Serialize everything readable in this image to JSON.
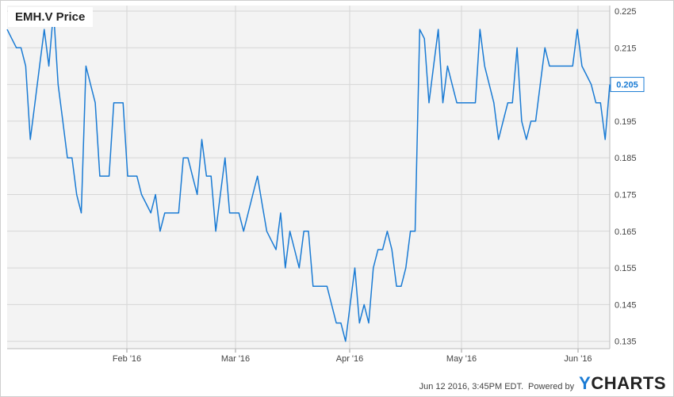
{
  "title": "EMH.V Price",
  "footer": {
    "timestamp": "Jun 12 2016, 3:45PM EDT.",
    "powered_by": "Powered by",
    "brand_y": "Y",
    "brand_rest": "CHARTS"
  },
  "chart_data": {
    "type": "line",
    "title": "EMH.V Price",
    "series": [
      {
        "values": [
          0.22,
          0.2175,
          0.215,
          0.215,
          0.21,
          0.19,
          0.2,
          0.21,
          0.22,
          0.21,
          0.225,
          0.205,
          0.195,
          0.185,
          0.185,
          0.175,
          0.17,
          0.21,
          0.205,
          0.2,
          0.18,
          0.18,
          0.18,
          0.2,
          0.2,
          0.2,
          0.18,
          0.18,
          0.18,
          0.175,
          0.1725,
          0.17,
          0.175,
          0.165,
          0.17,
          0.17,
          0.17,
          0.17,
          0.185,
          0.185,
          0.18,
          0.175,
          0.19,
          0.18,
          0.18,
          0.165,
          0.175,
          0.185,
          0.17,
          0.17,
          0.17,
          0.165,
          0.17,
          0.175,
          0.18,
          0.1725,
          0.165,
          0.1625,
          0.16,
          0.17,
          0.155,
          0.165,
          0.16,
          0.155,
          0.165,
          0.165,
          0.15,
          0.15,
          0.15,
          0.15,
          0.145,
          0.14,
          0.14,
          0.135,
          0.145,
          0.155,
          0.14,
          0.145,
          0.14,
          0.155,
          0.16,
          0.16,
          0.165,
          0.16,
          0.15,
          0.15,
          0.155,
          0.165,
          0.165,
          0.22,
          0.2175,
          0.2,
          0.21,
          0.22,
          0.2,
          0.21,
          0.205,
          0.2,
          0.2,
          0.2,
          0.2,
          0.2,
          0.22,
          0.21,
          0.205,
          0.2,
          0.19,
          0.195,
          0.2,
          0.2,
          0.215,
          0.195,
          0.19,
          0.195,
          0.195,
          0.205,
          0.215,
          0.21,
          0.21,
          0.21,
          0.21,
          0.21,
          0.21,
          0.22,
          0.21,
          0.2075,
          0.205,
          0.2,
          0.2,
          0.19,
          0.205
        ],
        "last_value_label": "0.205"
      }
    ],
    "x_ticks": [
      "Feb '16",
      "Mar '16",
      "Apr '16",
      "May '16",
      "Jun '16"
    ],
    "y_ticks": [
      "0.225",
      "0.215",
      "0.205",
      "0.195",
      "0.185",
      "0.175",
      "0.165",
      "0.155",
      "0.145",
      "0.135"
    ],
    "ylim": [
      0.133,
      0.2265
    ],
    "grid": true,
    "line_color": "#1a7bd4"
  }
}
